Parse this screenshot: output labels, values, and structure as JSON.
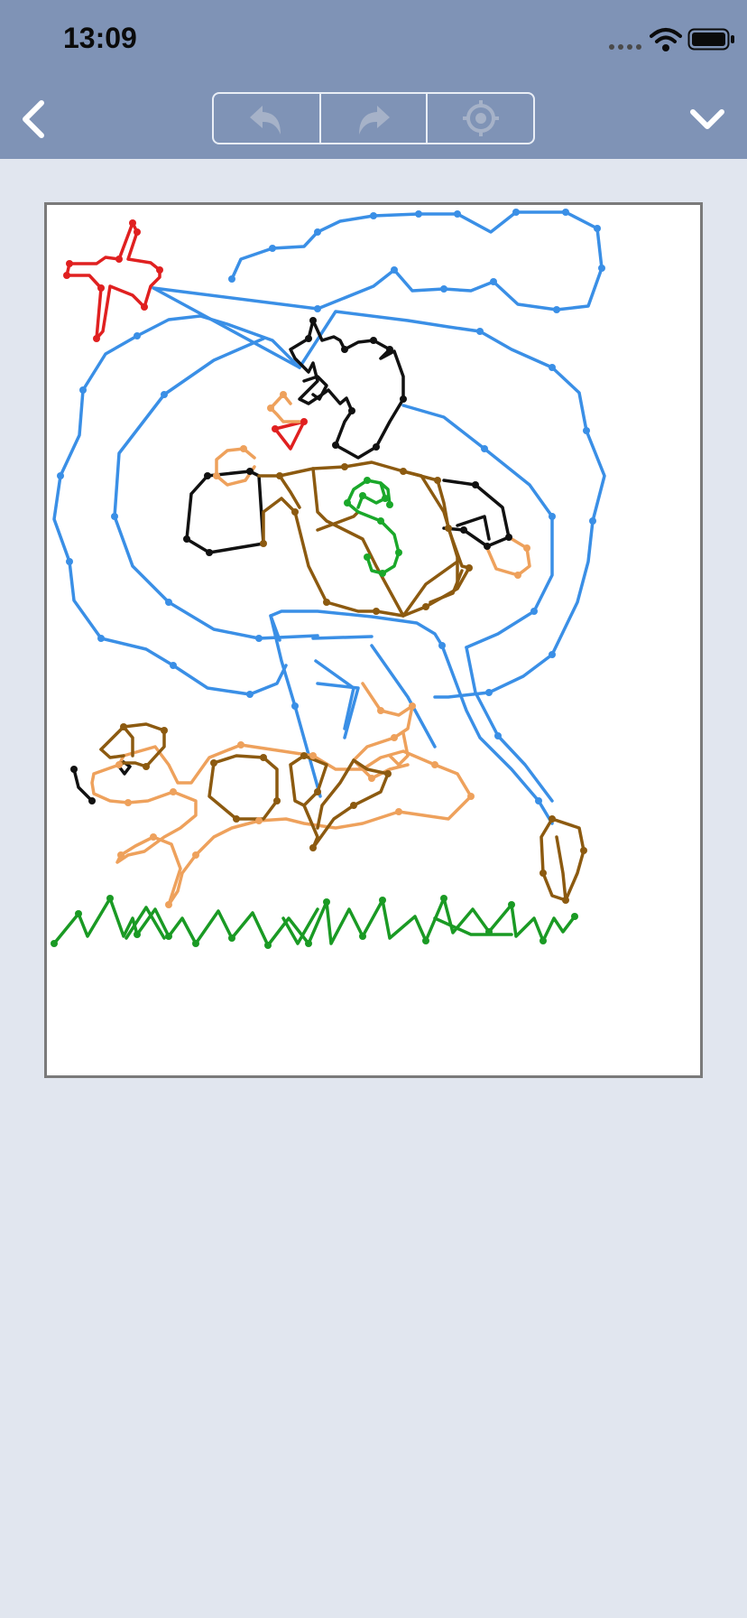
{
  "status_bar": {
    "time": "13:09",
    "icons": [
      "cellular-dots-icon",
      "wifi-icon",
      "battery-icon"
    ]
  },
  "toolbar": {
    "back_icon": "chevron-left-icon",
    "segments": [
      {
        "name": "undo",
        "icon": "undo-arrow-icon"
      },
      {
        "name": "redo",
        "icon": "redo-arrow-icon"
      },
      {
        "name": "locate",
        "icon": "crosshair-target-icon"
      }
    ],
    "menu_icon": "chevron-down-icon"
  },
  "drawing": {
    "colors": {
      "sky": "#3a8fe6",
      "plane": "#e02020",
      "hair": "#111111",
      "skin": "#eea15c",
      "shirt": "#8c5a10",
      "emblem": "#1aa82a",
      "grass": "#1a9a24"
    }
  },
  "theme": {
    "bar": "#7f93b6",
    "background": "#e1e6ef",
    "frame_border": "#7a7a7a"
  }
}
